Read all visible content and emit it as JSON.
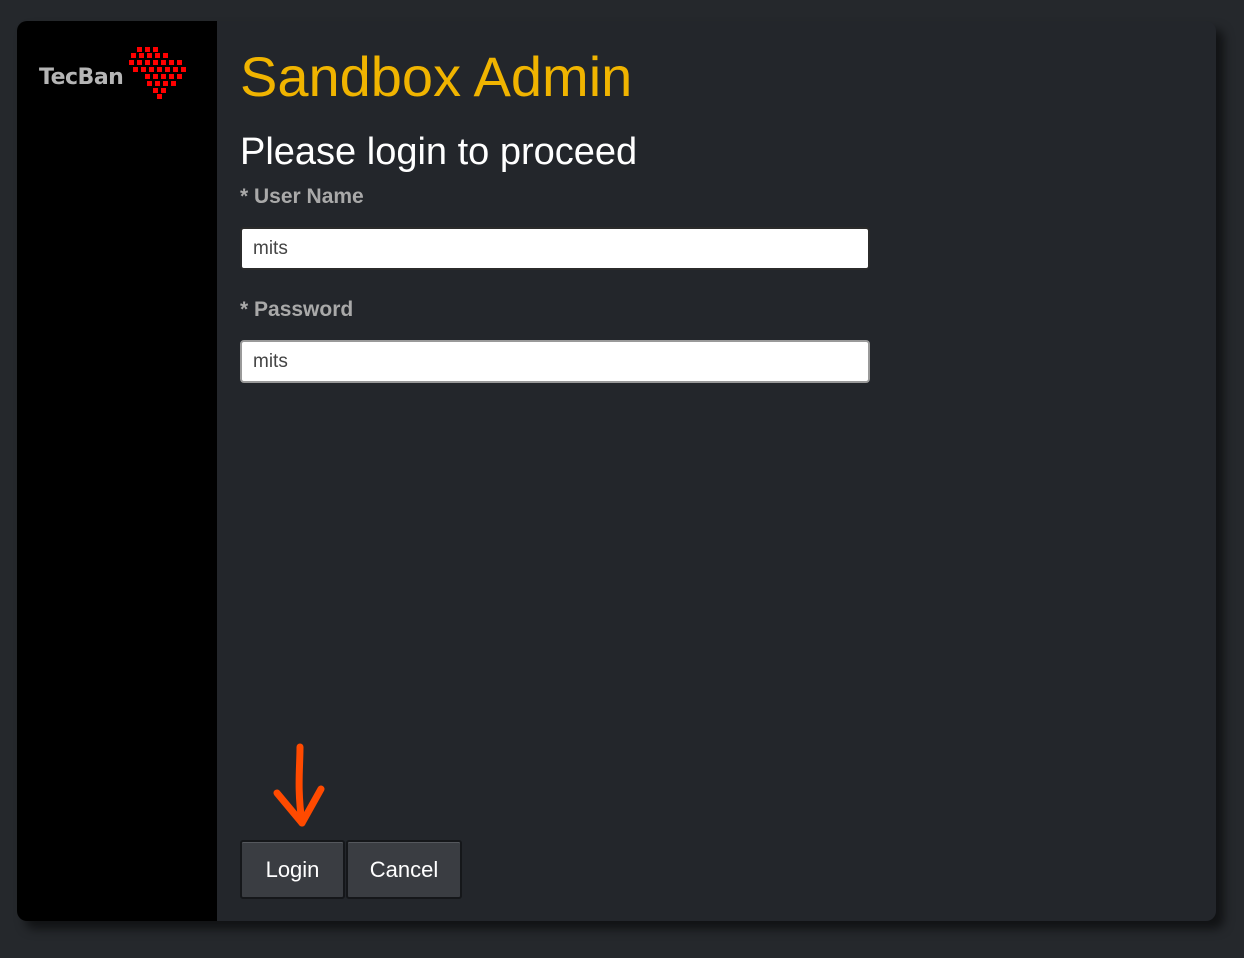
{
  "brand": {
    "logo_text": "TecBan",
    "logo_mark_color": "#ff0000"
  },
  "header": {
    "title": "Sandbox Admin",
    "subtitle": "Please login to proceed",
    "title_color": "#f0b400"
  },
  "form": {
    "username": {
      "label": "* User Name",
      "value": "mits"
    },
    "password": {
      "label": "* Password",
      "value": "mits"
    }
  },
  "actions": {
    "login_label": "Login",
    "cancel_label": "Cancel"
  },
  "annotation": {
    "icon": "arrow-down-icon",
    "color": "#ff4a00"
  }
}
